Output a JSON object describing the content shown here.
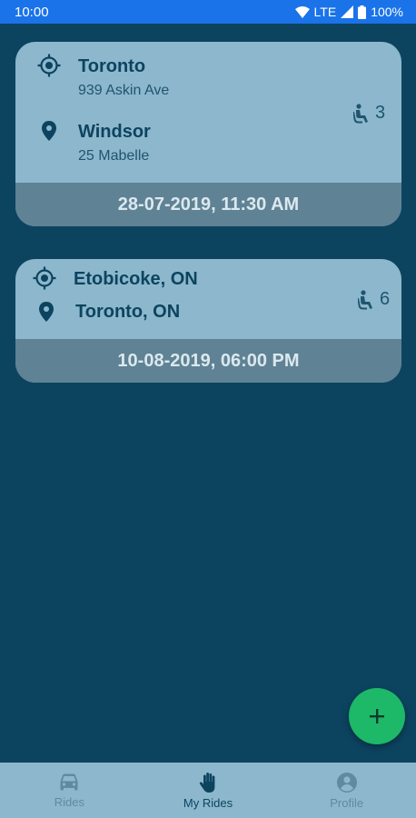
{
  "status_bar": {
    "time": "10:00",
    "network": "LTE",
    "battery": "100%",
    "icons": [
      "wifi-icon",
      "signal-icon",
      "battery-icon"
    ]
  },
  "rides": [
    {
      "from": {
        "city": "Toronto",
        "address": "939 Askin Ave"
      },
      "to": {
        "city": "Windsor",
        "address": "25 Mabelle"
      },
      "seats": "3",
      "datetime": "28-07-2019, 11:30 AM"
    },
    {
      "from": {
        "city": "Etobicoke, ON"
      },
      "to": {
        "city": "Toronto, ON"
      },
      "seats": "6",
      "datetime": "10-08-2019, 06:00 PM"
    }
  ],
  "fab": {
    "icon": "plus-icon"
  },
  "bottom_nav": {
    "items": [
      {
        "label": "Rides",
        "icon": "car-icon"
      },
      {
        "label": "My Rides",
        "icon": "hand-icon",
        "active": true
      },
      {
        "label": "Profile",
        "icon": "account-icon"
      }
    ]
  },
  "colors": {
    "background": "#0c4460",
    "card": "#8db7cc",
    "card_footer": "#5f8294",
    "status_bar": "#1a73e8",
    "fab": "#1db868"
  }
}
